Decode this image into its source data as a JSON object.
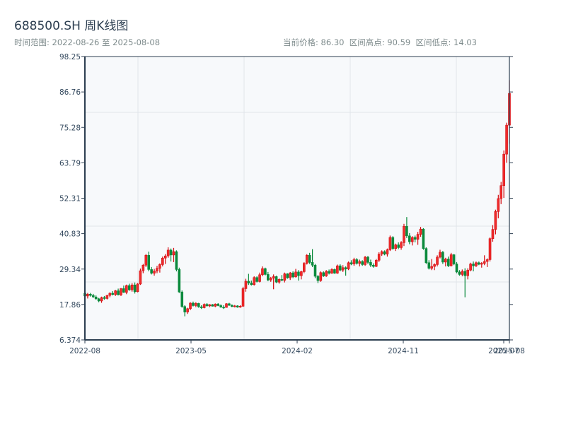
{
  "header": {
    "title": "688500.SH 周K线图",
    "range_text": "时间范围: 2022-08-26 至 2025-08-08",
    "stats_text": "当前价格: 86.30  区间高点: 90.59  区间低点: 14.03"
  },
  "chart_data": {
    "type": "candlestick",
    "title": "688500.SH 周K线图",
    "ylim": [
      6.374,
      98.25
    ],
    "y_ticks": [
      "6.374",
      "17.86",
      "29.34",
      "40.83",
      "52.31",
      "63.79",
      "75.28",
      "86.76",
      "98.25"
    ],
    "x_ticks": [
      "2022-08",
      "2023-05",
      "2024-02",
      "2024-11",
      "2025-07",
      "2025-08"
    ],
    "x_start": "2022-08-26",
    "x_end": "2025-08-08",
    "frequency": "weekly",
    "grid": true,
    "colors": {
      "up": "#d40d12",
      "down": "#0a8a3c"
    },
    "ohlc": [
      [
        21.5,
        22.0,
        20.0,
        20.6
      ],
      [
        20.6,
        21.6,
        19.8,
        21.2
      ],
      [
        21.2,
        21.6,
        20.4,
        20.8
      ],
      [
        20.8,
        21.3,
        20.0,
        20.3
      ],
      [
        20.3,
        20.8,
        19.4,
        19.7
      ],
      [
        19.7,
        20.0,
        18.6,
        19.0
      ],
      [
        19.0,
        20.4,
        18.4,
        20.1
      ],
      [
        20.1,
        20.6,
        19.4,
        19.8
      ],
      [
        19.8,
        21.0,
        19.5,
        20.8
      ],
      [
        20.8,
        21.8,
        20.2,
        21.5
      ],
      [
        21.5,
        22.2,
        20.8,
        21.1
      ],
      [
        21.1,
        22.6,
        20.6,
        22.3
      ],
      [
        22.3,
        23.0,
        20.8,
        21.0
      ],
      [
        21.0,
        23.2,
        20.6,
        23.0
      ],
      [
        23.0,
        24.0,
        21.6,
        21.8
      ],
      [
        21.8,
        24.3,
        21.2,
        24.0
      ],
      [
        24.0,
        24.6,
        22.3,
        22.6
      ],
      [
        22.6,
        24.8,
        22.0,
        24.2
      ],
      [
        24.2,
        25.0,
        21.4,
        22.0
      ],
      [
        22.0,
        24.8,
        21.8,
        24.5
      ],
      [
        24.5,
        29.5,
        24.2,
        28.8
      ],
      [
        28.8,
        31.0,
        28.0,
        30.6
      ],
      [
        30.6,
        34.2,
        30.0,
        33.8
      ],
      [
        33.8,
        35.0,
        28.6,
        29.2
      ],
      [
        29.2,
        30.0,
        27.6,
        28.0
      ],
      [
        28.0,
        29.4,
        27.2,
        28.7
      ],
      [
        28.7,
        30.4,
        28.0,
        29.6
      ],
      [
        29.6,
        31.2,
        28.2,
        30.8
      ],
      [
        30.8,
        33.4,
        30.2,
        32.9
      ],
      [
        32.9,
        34.2,
        31.0,
        33.6
      ],
      [
        33.6,
        36.4,
        33.0,
        35.5
      ],
      [
        35.5,
        36.0,
        31.8,
        33.9
      ],
      [
        33.9,
        36.2,
        31.6,
        35.0
      ],
      [
        35.0,
        35.4,
        28.6,
        29.2
      ],
      [
        29.2,
        29.8,
        21.6,
        21.9
      ],
      [
        21.9,
        22.4,
        16.8,
        17.2
      ],
      [
        17.2,
        17.6,
        14.03,
        15.4
      ],
      [
        15.4,
        16.8,
        14.8,
        16.5
      ],
      [
        16.5,
        18.6,
        16.0,
        18.3
      ],
      [
        18.3,
        18.8,
        17.2,
        17.5
      ],
      [
        17.5,
        18.6,
        17.0,
        18.2
      ],
      [
        18.2,
        18.4,
        16.8,
        17.1
      ],
      [
        17.1,
        17.6,
        16.4,
        16.8
      ],
      [
        16.8,
        18.2,
        16.6,
        17.9
      ],
      [
        17.9,
        18.3,
        17.2,
        17.4
      ],
      [
        17.4,
        18.0,
        17.0,
        17.8
      ],
      [
        17.8,
        18.0,
        17.2,
        17.3
      ],
      [
        17.3,
        18.2,
        17.0,
        18.0
      ],
      [
        18.0,
        18.3,
        17.3,
        17.5
      ],
      [
        17.5,
        17.9,
        16.8,
        17.0
      ],
      [
        17.0,
        17.6,
        16.4,
        16.9
      ],
      [
        16.9,
        18.3,
        16.8,
        18.1
      ],
      [
        18.1,
        18.4,
        17.4,
        17.6
      ],
      [
        17.6,
        17.9,
        17.0,
        17.2
      ],
      [
        17.2,
        17.7,
        16.9,
        17.4
      ],
      [
        17.4,
        17.6,
        16.8,
        17.0
      ],
      [
        17.0,
        17.6,
        16.8,
        17.3
      ],
      [
        17.3,
        23.6,
        17.1,
        23.0
      ],
      [
        23.0,
        26.2,
        22.0,
        25.4
      ],
      [
        25.4,
        27.8,
        24.2,
        24.8
      ],
      [
        24.8,
        25.6,
        24.0,
        24.3
      ],
      [
        24.3,
        27.0,
        24.0,
        26.6
      ],
      [
        26.6,
        27.0,
        25.0,
        25.3
      ],
      [
        25.3,
        28.2,
        25.0,
        27.5
      ],
      [
        27.5,
        30.2,
        27.0,
        29.5
      ],
      [
        29.5,
        29.8,
        27.3,
        27.6
      ],
      [
        27.6,
        28.4,
        25.4,
        25.8
      ],
      [
        25.8,
        26.8,
        25.2,
        26.4
      ],
      [
        26.4,
        27.6,
        22.8,
        26.9
      ],
      [
        26.9,
        27.2,
        24.8,
        25.1
      ],
      [
        25.1,
        26.3,
        24.6,
        26.0
      ],
      [
        26.0,
        27.4,
        25.4,
        25.7
      ],
      [
        25.7,
        28.2,
        25.0,
        27.8
      ],
      [
        27.8,
        28.0,
        26.2,
        26.5
      ],
      [
        26.5,
        28.4,
        25.8,
        28.1
      ],
      [
        28.1,
        28.6,
        26.4,
        26.8
      ],
      [
        26.8,
        29.4,
        26.6,
        28.4
      ],
      [
        28.4,
        29.0,
        25.6,
        27.2
      ],
      [
        27.2,
        28.8,
        26.0,
        28.5
      ],
      [
        28.5,
        31.6,
        28.0,
        31.2
      ],
      [
        31.2,
        34.2,
        30.8,
        33.8
      ],
      [
        33.8,
        34.6,
        31.0,
        31.5
      ],
      [
        31.5,
        35.8,
        30.0,
        30.6
      ],
      [
        30.6,
        31.0,
        26.4,
        27.0
      ],
      [
        27.0,
        27.4,
        24.8,
        25.6
      ],
      [
        25.6,
        28.6,
        25.2,
        28.2
      ],
      [
        28.2,
        28.6,
        26.8,
        27.1
      ],
      [
        27.1,
        29.0,
        26.8,
        28.6
      ],
      [
        28.6,
        29.2,
        27.6,
        28.0
      ],
      [
        28.0,
        29.6,
        27.8,
        29.2
      ],
      [
        29.2,
        29.5,
        27.8,
        28.0
      ],
      [
        28.0,
        30.8,
        27.8,
        30.4
      ],
      [
        30.4,
        30.9,
        28.6,
        29.0
      ],
      [
        29.0,
        30.6,
        28.4,
        29.8
      ],
      [
        29.8,
        30.2,
        27.2,
        29.4
      ],
      [
        29.4,
        31.8,
        29.0,
        31.4
      ],
      [
        31.4,
        32.2,
        30.6,
        31.0
      ],
      [
        31.0,
        33.0,
        30.4,
        32.4
      ],
      [
        32.4,
        32.9,
        30.8,
        31.2
      ],
      [
        31.2,
        32.4,
        30.2,
        31.8
      ],
      [
        31.8,
        32.2,
        30.4,
        30.8
      ],
      [
        30.8,
        33.6,
        30.4,
        33.2
      ],
      [
        33.2,
        33.6,
        31.0,
        31.5
      ],
      [
        31.5,
        32.4,
        30.0,
        30.6
      ],
      [
        30.6,
        31.2,
        29.8,
        30.2
      ],
      [
        30.2,
        32.6,
        30.0,
        32.2
      ],
      [
        32.2,
        34.8,
        31.6,
        34.2
      ],
      [
        34.2,
        35.4,
        33.6,
        35.0
      ],
      [
        35.0,
        35.4,
        33.8,
        34.2
      ],
      [
        34.2,
        36.0,
        33.4,
        35.6
      ],
      [
        35.6,
        40.2,
        35.2,
        39.6
      ],
      [
        39.6,
        40.0,
        35.6,
        36.0
      ],
      [
        36.0,
        37.6,
        35.2,
        37.2
      ],
      [
        37.2,
        38.0,
        35.8,
        36.3
      ],
      [
        36.3,
        38.4,
        35.6,
        37.9
      ],
      [
        37.9,
        44.0,
        36.8,
        43.2
      ],
      [
        43.2,
        46.2,
        39.4,
        40.1
      ],
      [
        40.1,
        41.0,
        37.4,
        38.2
      ],
      [
        38.2,
        40.0,
        37.0,
        39.6
      ],
      [
        39.6,
        40.2,
        38.0,
        39.0
      ],
      [
        39.0,
        41.4,
        37.2,
        40.6
      ],
      [
        40.6,
        43.0,
        39.8,
        42.3
      ],
      [
        42.3,
        42.6,
        35.6,
        36.0
      ],
      [
        36.0,
        36.4,
        31.0,
        31.4
      ],
      [
        31.4,
        32.2,
        29.2,
        29.6
      ],
      [
        29.6,
        32.6,
        29.0,
        30.2
      ],
      [
        30.2,
        31.2,
        29.0,
        30.8
      ],
      [
        30.8,
        33.8,
        30.2,
        33.2
      ],
      [
        33.2,
        35.6,
        32.8,
        34.8
      ],
      [
        34.8,
        35.2,
        31.0,
        31.6
      ],
      [
        31.6,
        33.0,
        30.2,
        32.6
      ],
      [
        32.6,
        33.4,
        30.0,
        30.4
      ],
      [
        30.4,
        34.6,
        30.2,
        34.0
      ],
      [
        34.0,
        34.2,
        30.6,
        31.0
      ],
      [
        31.0,
        31.6,
        28.0,
        28.4
      ],
      [
        28.4,
        29.0,
        27.2,
        27.6
      ],
      [
        27.6,
        29.2,
        27.0,
        28.6
      ],
      [
        28.6,
        29.6,
        20.2,
        27.2
      ],
      [
        27.2,
        29.6,
        26.0,
        29.0
      ],
      [
        29.0,
        31.4,
        28.6,
        31.0
      ],
      [
        31.0,
        31.8,
        28.6,
        30.4
      ],
      [
        30.4,
        31.8,
        30.0,
        31.4
      ],
      [
        31.4,
        31.8,
        30.6,
        30.9
      ],
      [
        30.9,
        31.6,
        29.8,
        31.2
      ],
      [
        31.2,
        33.8,
        30.6,
        31.8
      ],
      [
        31.8,
        32.8,
        30.0,
        32.4
      ],
      [
        32.4,
        39.6,
        31.8,
        39.2
      ],
      [
        39.2,
        43.6,
        38.2,
        42.2
      ],
      [
        42.2,
        48.6,
        40.6,
        48.0
      ],
      [
        48.0,
        53.4,
        45.8,
        52.2
      ],
      [
        52.2,
        57.6,
        50.4,
        56.4
      ],
      [
        56.4,
        67.8,
        52.4,
        66.6
      ],
      [
        66.6,
        76.8,
        63.8,
        76.0
      ],
      [
        76.0,
        90.59,
        70.0,
        86.3
      ]
    ]
  }
}
